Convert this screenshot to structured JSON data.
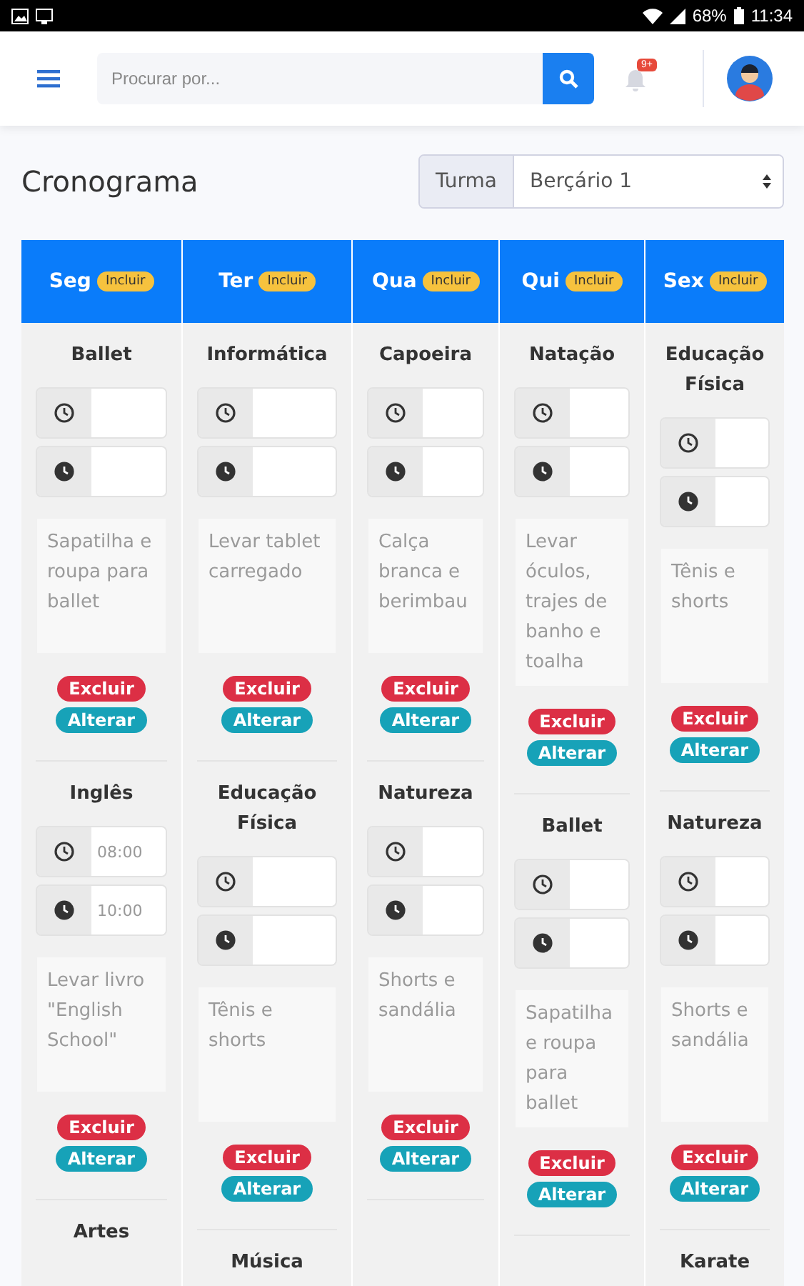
{
  "status_bar": {
    "battery": "68%",
    "time": "11:34"
  },
  "topbar": {
    "search": {
      "placeholder": "Procurar por..."
    },
    "notifications_badge": "9+"
  },
  "page": {
    "title": "Cronograma",
    "class_filter": {
      "label": "Turma",
      "value": "Berçário 1"
    }
  },
  "days": [
    {
      "label": "Seg",
      "add_label": "Incluir",
      "items": [
        {
          "kind": "full",
          "title": "Ballet",
          "note": "Sapatilha e roupa para ballet",
          "delete_label": "Excluir",
          "edit_label": "Alterar"
        },
        {
          "kind": "full",
          "title": "Inglês",
          "start": "08:00",
          "end": "10:00",
          "note": "Levar livro \"English School\"",
          "delete_label": "Excluir",
          "edit_label": "Alterar"
        },
        {
          "kind": "title_only",
          "title": "Artes"
        }
      ]
    },
    {
      "label": "Ter",
      "add_label": "Incluir",
      "items": [
        {
          "kind": "full",
          "title": "Informática",
          "note": "Levar tablet carregado",
          "delete_label": "Excluir",
          "edit_label": "Alterar"
        },
        {
          "kind": "full",
          "title": "Educação Física",
          "note": "Tênis e shorts",
          "delete_label": "Excluir",
          "edit_label": "Alterar"
        },
        {
          "kind": "title_only",
          "title": "Música"
        }
      ]
    },
    {
      "label": "Qua",
      "add_label": "Incluir",
      "items": [
        {
          "kind": "full",
          "title": "Capoeira",
          "note": "Calça branca e berimbau",
          "delete_label": "Excluir",
          "edit_label": "Alterar"
        },
        {
          "kind": "full",
          "title": "Natureza",
          "note": "Shorts e sandália",
          "delete_label": "Excluir",
          "edit_label": "Alterar"
        }
      ]
    },
    {
      "label": "Qui",
      "add_label": "Incluir",
      "items": [
        {
          "kind": "full",
          "title": "Natação",
          "note": "Levar óculos, trajes de banho e toalha",
          "delete_label": "Excluir",
          "edit_label": "Alterar"
        },
        {
          "kind": "full",
          "title": "Ballet",
          "note": "Sapatilha e roupa para ballet",
          "delete_label": "Excluir",
          "edit_label": "Alterar"
        }
      ]
    },
    {
      "label": "Sex",
      "add_label": "Incluir",
      "items": [
        {
          "kind": "full",
          "title": "Educação Física",
          "note": "Tênis e shorts",
          "delete_label": "Excluir",
          "edit_label": "Alterar"
        },
        {
          "kind": "full",
          "title": "Natureza",
          "note": "Shorts e sandália",
          "delete_label": "Excluir",
          "edit_label": "Alterar"
        },
        {
          "kind": "title_only",
          "title": "Karate"
        }
      ]
    }
  ]
}
